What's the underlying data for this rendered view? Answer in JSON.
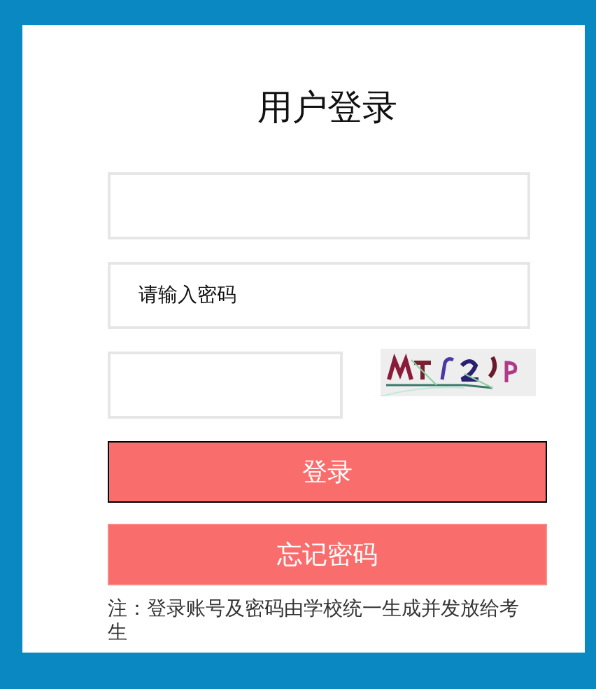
{
  "title": "用户登录",
  "password_field": {
    "placeholder": "请输入密码"
  },
  "buttons": [
    {
      "label": "登录",
      "focused": true
    },
    {
      "label": "忘记密码",
      "focused": false
    }
  ],
  "note": "注：登录账号及密码由学校统一生成并发放给考生"
}
